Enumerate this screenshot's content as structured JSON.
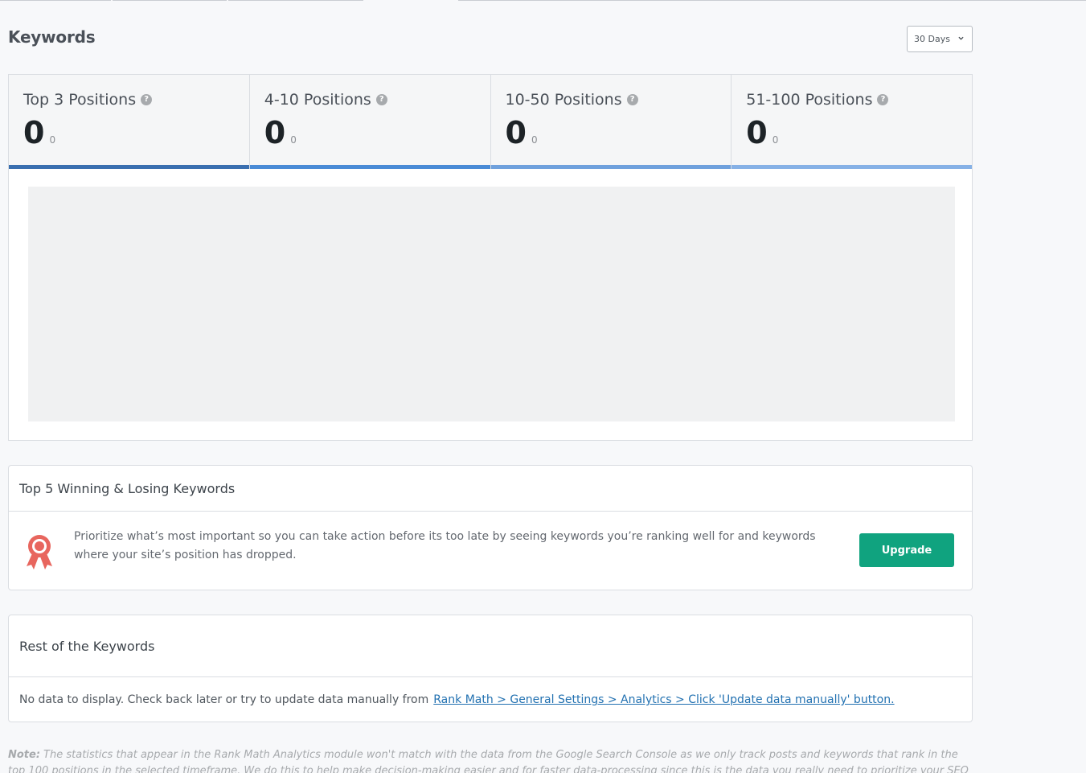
{
  "page": {
    "title": "Keywords"
  },
  "range": {
    "selected": "30 Days"
  },
  "positions": [
    {
      "label": "Top 3 Positions",
      "value": "0",
      "change": "0",
      "bar_color": "#3a6fb0"
    },
    {
      "label": "4-10 Positions",
      "value": "0",
      "change": "0",
      "bar_color": "#4a8bd6"
    },
    {
      "label": "10-50 Positions",
      "value": "0",
      "change": "0",
      "bar_color": "#6fa1dd"
    },
    {
      "label": "51-100 Positions",
      "value": "0",
      "change": "0",
      "bar_color": "#86b1e6"
    }
  ],
  "winning": {
    "title": "Top 5 Winning & Losing Keywords",
    "text": "Prioritize what’s most important so you can take action before its too late by seeing keywords you’re ranking well for and keywords where your site’s position has dropped.",
    "button": "Upgrade",
    "icon": "award-ribbon-icon"
  },
  "rest": {
    "title": "Rest of the Keywords",
    "message": "No data to display. Check back later or try to update data manually from",
    "link": "Rank Math > General Settings > Analytics > Click 'Update data manually' button."
  },
  "note": {
    "label": "Note:",
    "text": "The statistics that appear in the Rank Math Analytics module won't match with the data from the Google Search Console as we only track posts and keywords that rank in the top 100 positions in the selected timeframe. We do this to help make decision-making easier and for faster data-processing since this is the data you really need to prioritize your SEO efforts on."
  },
  "colors": {
    "accent": "#10a37f",
    "link": "#2271b1",
    "ribbon": "#e8665e"
  }
}
